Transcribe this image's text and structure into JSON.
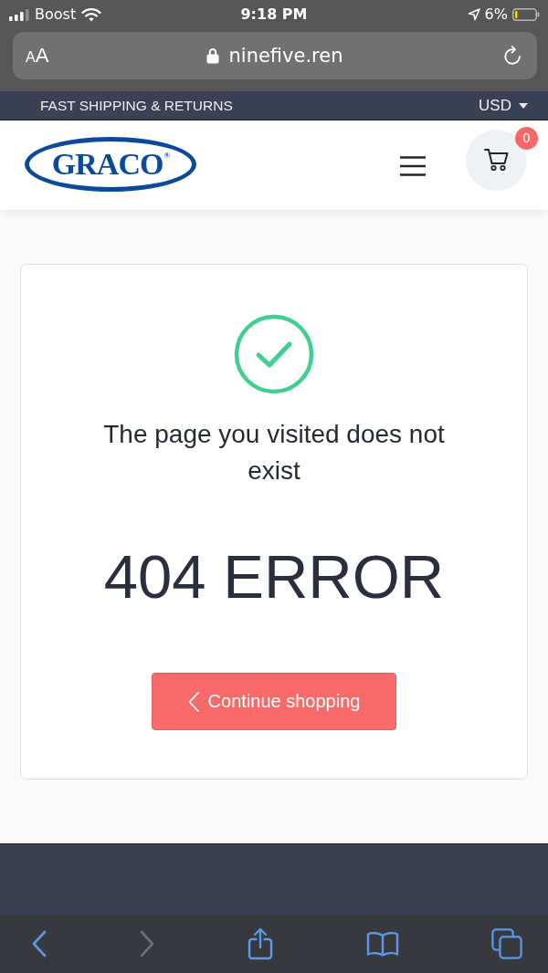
{
  "status_bar": {
    "carrier": "Boost",
    "time": "9:18 PM",
    "battery": "6%",
    "low_power_mode": true
  },
  "address_bar": {
    "text_size_small": "A",
    "text_size_large": "A",
    "url": "ninefive.ren",
    "secure": true
  },
  "promo_bar": {
    "text": "FAST SHIPPING & RETURNS",
    "currency": "USD"
  },
  "header": {
    "logo": "GRACO$^{®}$",
    "cart_count": "0"
  },
  "error_card": {
    "message": "The page you visited does not exist",
    "code": "404 ERROR",
    "button": "Continue shopping"
  },
  "toolbar": {
    "buttons": [
      {
        "kind": "back",
        "disabled": false
      },
      {
        "kind": "forward",
        "disabled": true
      },
      {
        "kind": "share",
        "disabled": false
      },
      {
        "kind": "bookmarks",
        "disabled": false
      },
      {
        "kind": "tabs",
        "disabled": false
      }
    ]
  }
}
